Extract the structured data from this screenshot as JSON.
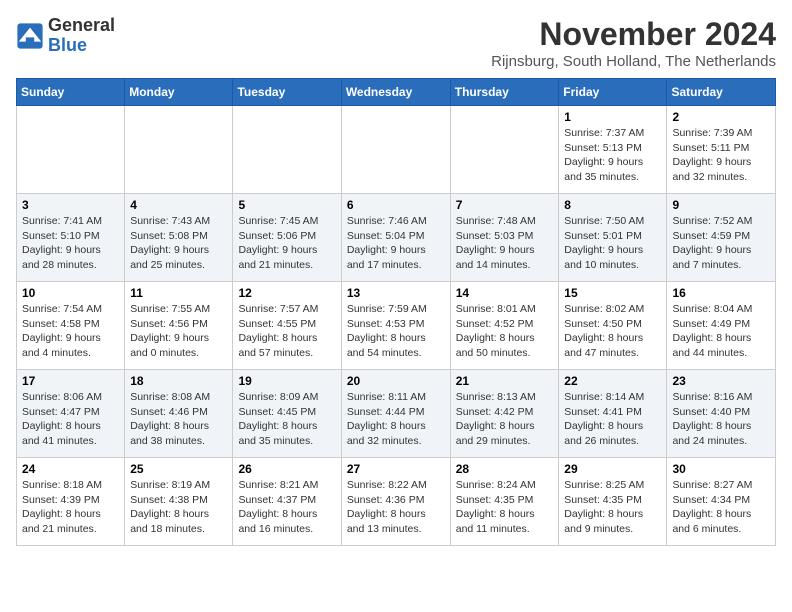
{
  "logo": {
    "general": "General",
    "blue": "Blue"
  },
  "title": "November 2024",
  "subtitle": "Rijnsburg, South Holland, The Netherlands",
  "headers": [
    "Sunday",
    "Monday",
    "Tuesday",
    "Wednesday",
    "Thursday",
    "Friday",
    "Saturday"
  ],
  "weeks": [
    [
      {
        "day": "",
        "content": ""
      },
      {
        "day": "",
        "content": ""
      },
      {
        "day": "",
        "content": ""
      },
      {
        "day": "",
        "content": ""
      },
      {
        "day": "",
        "content": ""
      },
      {
        "day": "1",
        "content": "Sunrise: 7:37 AM\nSunset: 5:13 PM\nDaylight: 9 hours and 35 minutes."
      },
      {
        "day": "2",
        "content": "Sunrise: 7:39 AM\nSunset: 5:11 PM\nDaylight: 9 hours and 32 minutes."
      }
    ],
    [
      {
        "day": "3",
        "content": "Sunrise: 7:41 AM\nSunset: 5:10 PM\nDaylight: 9 hours and 28 minutes."
      },
      {
        "day": "4",
        "content": "Sunrise: 7:43 AM\nSunset: 5:08 PM\nDaylight: 9 hours and 25 minutes."
      },
      {
        "day": "5",
        "content": "Sunrise: 7:45 AM\nSunset: 5:06 PM\nDaylight: 9 hours and 21 minutes."
      },
      {
        "day": "6",
        "content": "Sunrise: 7:46 AM\nSunset: 5:04 PM\nDaylight: 9 hours and 17 minutes."
      },
      {
        "day": "7",
        "content": "Sunrise: 7:48 AM\nSunset: 5:03 PM\nDaylight: 9 hours and 14 minutes."
      },
      {
        "day": "8",
        "content": "Sunrise: 7:50 AM\nSunset: 5:01 PM\nDaylight: 9 hours and 10 minutes."
      },
      {
        "day": "9",
        "content": "Sunrise: 7:52 AM\nSunset: 4:59 PM\nDaylight: 9 hours and 7 minutes."
      }
    ],
    [
      {
        "day": "10",
        "content": "Sunrise: 7:54 AM\nSunset: 4:58 PM\nDaylight: 9 hours and 4 minutes."
      },
      {
        "day": "11",
        "content": "Sunrise: 7:55 AM\nSunset: 4:56 PM\nDaylight: 9 hours and 0 minutes."
      },
      {
        "day": "12",
        "content": "Sunrise: 7:57 AM\nSunset: 4:55 PM\nDaylight: 8 hours and 57 minutes."
      },
      {
        "day": "13",
        "content": "Sunrise: 7:59 AM\nSunset: 4:53 PM\nDaylight: 8 hours and 54 minutes."
      },
      {
        "day": "14",
        "content": "Sunrise: 8:01 AM\nSunset: 4:52 PM\nDaylight: 8 hours and 50 minutes."
      },
      {
        "day": "15",
        "content": "Sunrise: 8:02 AM\nSunset: 4:50 PM\nDaylight: 8 hours and 47 minutes."
      },
      {
        "day": "16",
        "content": "Sunrise: 8:04 AM\nSunset: 4:49 PM\nDaylight: 8 hours and 44 minutes."
      }
    ],
    [
      {
        "day": "17",
        "content": "Sunrise: 8:06 AM\nSunset: 4:47 PM\nDaylight: 8 hours and 41 minutes."
      },
      {
        "day": "18",
        "content": "Sunrise: 8:08 AM\nSunset: 4:46 PM\nDaylight: 8 hours and 38 minutes."
      },
      {
        "day": "19",
        "content": "Sunrise: 8:09 AM\nSunset: 4:45 PM\nDaylight: 8 hours and 35 minutes."
      },
      {
        "day": "20",
        "content": "Sunrise: 8:11 AM\nSunset: 4:44 PM\nDaylight: 8 hours and 32 minutes."
      },
      {
        "day": "21",
        "content": "Sunrise: 8:13 AM\nSunset: 4:42 PM\nDaylight: 8 hours and 29 minutes."
      },
      {
        "day": "22",
        "content": "Sunrise: 8:14 AM\nSunset: 4:41 PM\nDaylight: 8 hours and 26 minutes."
      },
      {
        "day": "23",
        "content": "Sunrise: 8:16 AM\nSunset: 4:40 PM\nDaylight: 8 hours and 24 minutes."
      }
    ],
    [
      {
        "day": "24",
        "content": "Sunrise: 8:18 AM\nSunset: 4:39 PM\nDaylight: 8 hours and 21 minutes."
      },
      {
        "day": "25",
        "content": "Sunrise: 8:19 AM\nSunset: 4:38 PM\nDaylight: 8 hours and 18 minutes."
      },
      {
        "day": "26",
        "content": "Sunrise: 8:21 AM\nSunset: 4:37 PM\nDaylight: 8 hours and 16 minutes."
      },
      {
        "day": "27",
        "content": "Sunrise: 8:22 AM\nSunset: 4:36 PM\nDaylight: 8 hours and 13 minutes."
      },
      {
        "day": "28",
        "content": "Sunrise: 8:24 AM\nSunset: 4:35 PM\nDaylight: 8 hours and 11 minutes."
      },
      {
        "day": "29",
        "content": "Sunrise: 8:25 AM\nSunset: 4:35 PM\nDaylight: 8 hours and 9 minutes."
      },
      {
        "day": "30",
        "content": "Sunrise: 8:27 AM\nSunset: 4:34 PM\nDaylight: 8 hours and 6 minutes."
      }
    ]
  ]
}
